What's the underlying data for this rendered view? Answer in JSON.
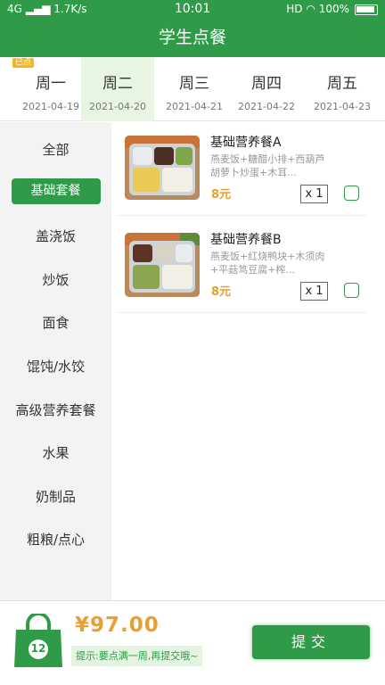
{
  "status_bar": {
    "network": "4G",
    "speed": "1.7K/s",
    "time": "10:01",
    "hd": "HD",
    "battery_pct": "100%"
  },
  "header": {
    "title": "学生点餐"
  },
  "days": [
    {
      "name": "周一",
      "date": "2021-04-19",
      "badge": "已点"
    },
    {
      "name": "周二",
      "date": "2021-04-20"
    },
    {
      "name": "周三",
      "date": "2021-04-21"
    },
    {
      "name": "周四",
      "date": "2021-04-22"
    },
    {
      "name": "周五",
      "date": "2021-04-23"
    }
  ],
  "categories": [
    "全部",
    "基础套餐",
    "盖浇饭",
    "炒饭",
    "面食",
    "馄饨/水饺",
    "高级营养套餐",
    "水果",
    "奶制品",
    "粗粮/点心"
  ],
  "items": [
    {
      "name": "基础营养餐A",
      "desc": "燕麦饭+糖醋小排+西葫芦胡萝卜炒蛋+木耳...",
      "price": "8元",
      "qty": "x 1"
    },
    {
      "name": "基础营养餐B",
      "desc": "燕麦饭+红烧鸭块+木须肉+平菇笃豆腐+榨...",
      "price": "8元",
      "qty": "x 1"
    }
  ],
  "footer": {
    "cart_count": "12",
    "total": "¥97.00",
    "tip": "提示:要点满一周,再提交哦~",
    "submit_label": "提交"
  },
  "colors": {
    "brand_green": "#2f9b48",
    "price_orange": "#e8a030",
    "badge_yellow": "#f0b72a"
  }
}
